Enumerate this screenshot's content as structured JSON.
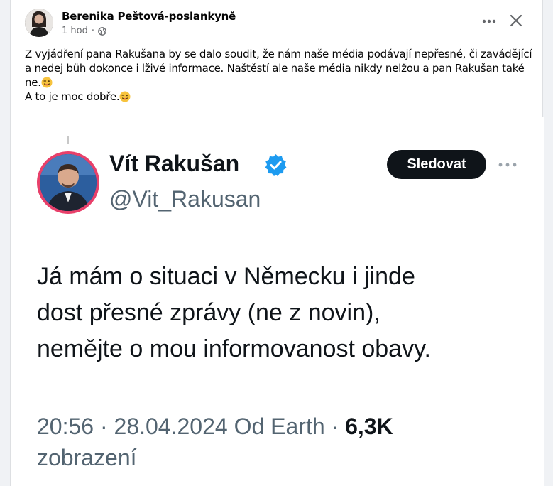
{
  "post": {
    "author_name": "Berenika Peštová-poslankyně",
    "timestamp": "1 hod",
    "dot": "·",
    "privacy_icon": "globe-icon",
    "text_lines": [
      "Z vyjádření pana Rakušana by se dalo soudit, že nám naše média podávají nepřesné, či zavádějící a nedej bůh dokonce i lživé informace. Naštěstí ale naše média nikdy nelžou a pan Rakušan také ne.",
      "A to je moc dobře."
    ],
    "emoji": "winking-face-emoji",
    "more_icon": "more-horizontal-icon",
    "close_icon": "close-icon"
  },
  "tweet": {
    "name": "Vít Rakušan",
    "handle": "@Vit_Rakusan",
    "follow_label": "Sledovat",
    "verified_icon": "verified-badge-icon",
    "body_lines": [
      "Já mám o situaci v Německu i jinde",
      "dost přesné zprávy (ne z novin),",
      "nemějte o mou informovanost obavy."
    ],
    "time_date": "20:56 · 28.04.2024 Od Earth · ",
    "views_count": "6,3K",
    "views_label": "zobrazení"
  },
  "colors": {
    "follow_bg": "#0f1419",
    "verified": "#1d9bf0",
    "avatar_ring": "#e8406a",
    "secondary_text": "#536471"
  }
}
